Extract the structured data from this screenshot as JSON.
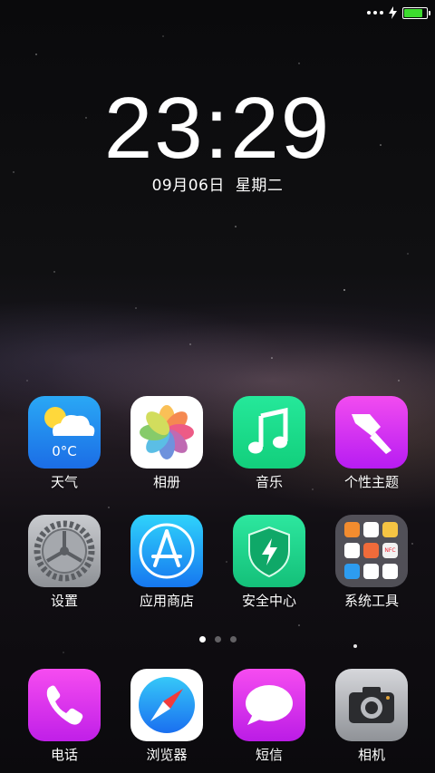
{
  "status_bar": {
    "signal_icon": "signal-dots-icon",
    "charging_icon": "lightning-icon",
    "battery_icon": "battery-icon",
    "battery_level": 0.85,
    "battery_color": "#3ddc2f"
  },
  "lockscreen": {
    "time": "23:29",
    "date": "09月06日",
    "weekday": "星期二"
  },
  "apps": [
    {
      "label": "天气",
      "icon": "weather-icon",
      "temperature": "0°C"
    },
    {
      "label": "相册",
      "icon": "photos-icon"
    },
    {
      "label": "音乐",
      "icon": "music-note-icon"
    },
    {
      "label": "个性主题",
      "icon": "paintbrush-icon"
    },
    {
      "label": "设置",
      "icon": "gear-icon"
    },
    {
      "label": "应用商店",
      "icon": "app-store-icon"
    },
    {
      "label": "安全中心",
      "icon": "shield-icon"
    },
    {
      "label": "系统工具",
      "icon": "folder-icon",
      "badge": "NFC"
    }
  ],
  "pager": {
    "pages": 3,
    "active": 1
  },
  "dock": [
    {
      "label": "电话",
      "icon": "phone-icon"
    },
    {
      "label": "浏览器",
      "icon": "compass-icon"
    },
    {
      "label": "短信",
      "icon": "message-bubble-icon"
    },
    {
      "label": "相机",
      "icon": "camera-icon"
    }
  ]
}
